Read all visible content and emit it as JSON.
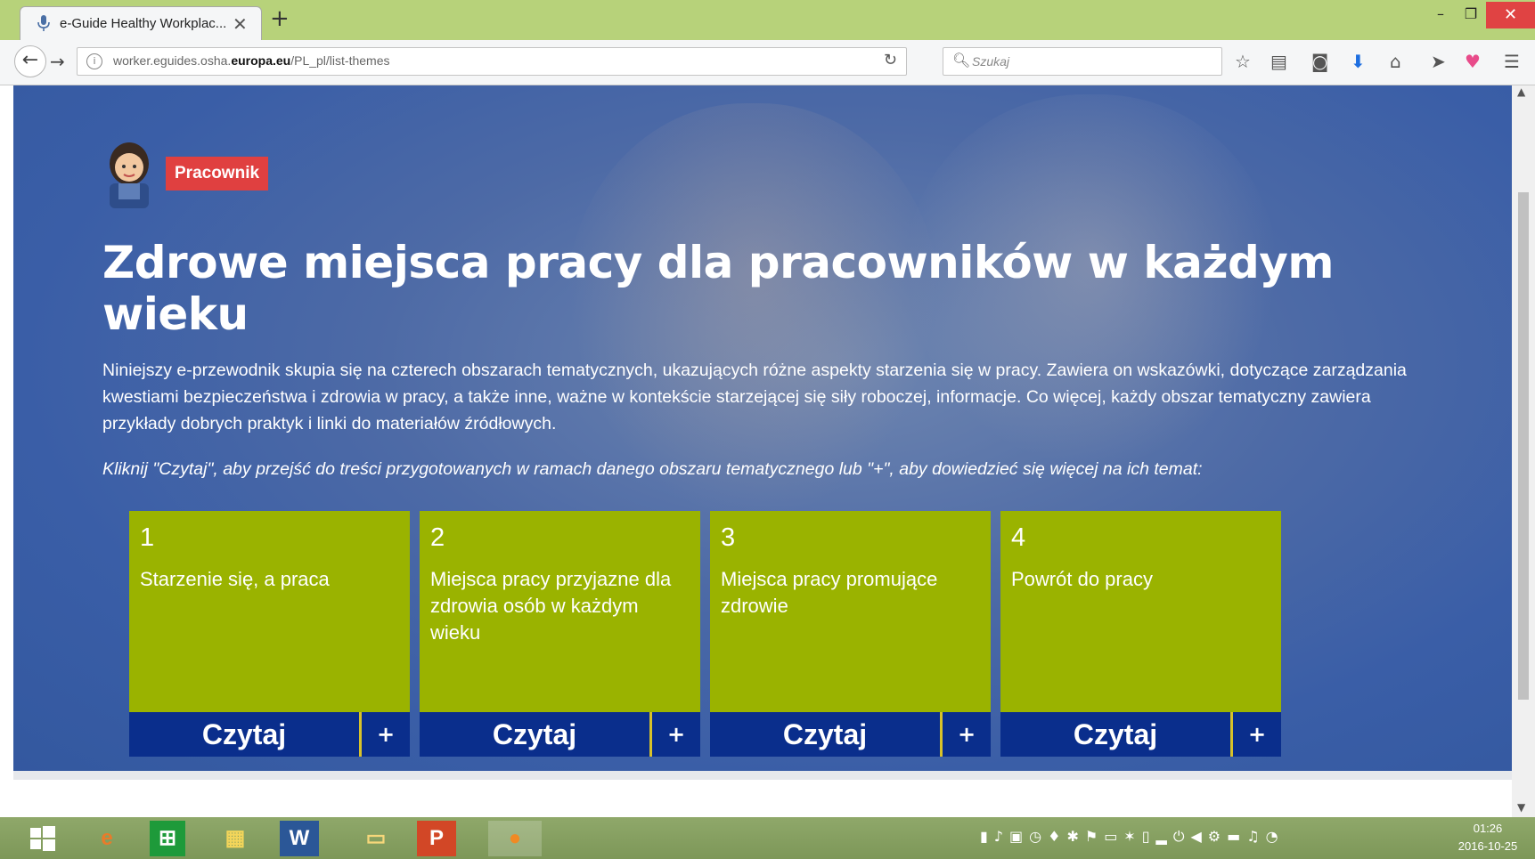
{
  "browser": {
    "tab_title": "e-Guide Healthy Workplac...",
    "url_plain_prefix": "worker.eguides.osha.",
    "url_domain": "europa.eu",
    "url_path": "/PL_pl/list-themes",
    "search_placeholder": "Szukaj"
  },
  "header": {
    "badge_label": "Pracownik"
  },
  "hero": {
    "title": "Zdrowe miejsca pracy dla pracowników w każdym wieku",
    "description": "Niniejszy e-przewodnik skupia się na czterech obszarach tematycznych, ukazujących różne aspekty starzenia się w pracy. Zawiera on wskazówki, dotyczące zarządzania kwestiami bezpieczeństwa i zdrowia w pracy, a także inne, ważne w kontekście starzejącej się siły roboczej, informacje. Co więcej, każdy obszar tematyczny zawiera przykłady dobrych praktyk i linki do materiałów źródłowych.",
    "instruction": "Kliknij \"Czytaj\", aby przejść do treści przygotowanych w ramach danego obszaru tematycznego lub \"+\", aby dowiedzieć się więcej na ich temat:"
  },
  "cards": [
    {
      "number": "1",
      "title": "Starzenie się, a praca",
      "read_label": "Czytaj",
      "more_label": "+"
    },
    {
      "number": "2",
      "title": "Miejsca pracy przyjazne dla zdrowia osób w każdym wieku",
      "read_label": "Czytaj",
      "more_label": "+"
    },
    {
      "number": "3",
      "title": "Miejsca pracy promujące zdrowie",
      "read_label": "Czytaj",
      "more_label": "+"
    },
    {
      "number": "4",
      "title": "Powrót do pracy",
      "read_label": "Czytaj",
      "more_label": "+"
    }
  ],
  "taskbar": {
    "time": "01:26",
    "date": "2016-10-25"
  },
  "colors": {
    "card_green": "#9ab300",
    "button_blue": "#0a2e8c",
    "badge_red": "#e04040",
    "background_blue": "#3a5ea7"
  }
}
